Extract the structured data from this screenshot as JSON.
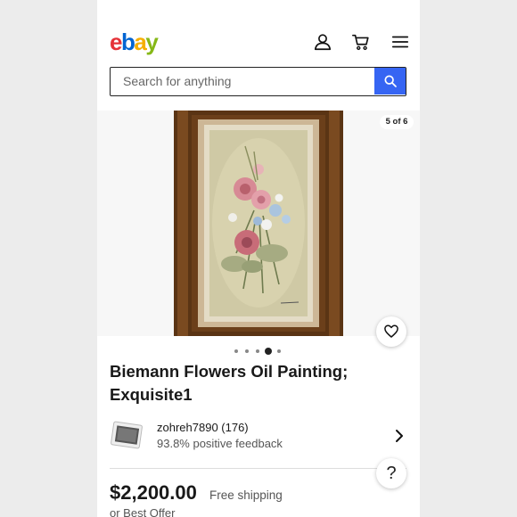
{
  "header": {
    "logo_letters": [
      {
        "ch": "e",
        "color": "#e53238"
      },
      {
        "ch": "b",
        "color": "#0064d2"
      },
      {
        "ch": "a",
        "color": "#f5af02"
      },
      {
        "ch": "y",
        "color": "#86b817"
      }
    ],
    "icons": [
      "account-icon",
      "cart-icon",
      "menu-icon"
    ]
  },
  "search": {
    "placeholder": "Search for anything",
    "button_icon": "search-icon"
  },
  "gallery": {
    "counter": "5 of 6",
    "dot_count": 5,
    "active_dot": 4
  },
  "item": {
    "title": "Biemann Flowers Oil Painting; Exquisite1"
  },
  "seller": {
    "name": "zohreh7890 (176)",
    "feedback": "93.8% positive feedback"
  },
  "price": {
    "amount": "$2,200.00",
    "shipping": "Free shipping",
    "offer": "or Best Offer"
  },
  "help": {
    "label": "?"
  },
  "colors": {
    "accent": "#3665f3"
  }
}
